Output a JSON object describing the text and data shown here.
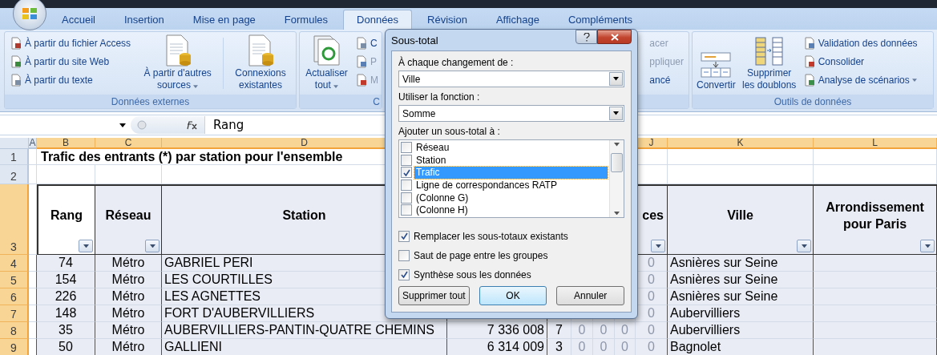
{
  "tabs": [
    {
      "label": "Accueil",
      "selected": false
    },
    {
      "label": "Insertion",
      "selected": false
    },
    {
      "label": "Mise en page",
      "selected": false
    },
    {
      "label": "Formules",
      "selected": false
    },
    {
      "label": "Données",
      "selected": true
    },
    {
      "label": "Révision",
      "selected": false
    },
    {
      "label": "Affichage",
      "selected": false
    },
    {
      "label": "Compléments",
      "selected": false
    }
  ],
  "ribbon": {
    "external_data": {
      "items": [
        "À partir du fichier Access",
        "À partir du site Web",
        "À partir du texte"
      ],
      "large": [
        {
          "label": "À partir d'autres sources",
          "menu": true
        },
        {
          "label": "Connexions existantes",
          "menu": false
        }
      ],
      "label": "Données externes"
    },
    "connections": {
      "large": {
        "label": "Actualiser tout",
        "menu": true
      },
      "items": [
        "C",
        "P",
        "M"
      ],
      "label": "C"
    },
    "sort_filter": {
      "items": [
        {
          "label": "acer",
          "disabled": true
        },
        {
          "label": "ppliquer",
          "disabled": true
        },
        {
          "label": "ancé",
          "disabled": false
        }
      ]
    },
    "data_tools": {
      "large": [
        {
          "label": "Convertir",
          "menu": false
        },
        {
          "label": "Supprimer les doublons",
          "menu": false
        }
      ],
      "items": [
        {
          "label": "Validation des données",
          "menu": false
        },
        {
          "label": "Consolider",
          "menu": false
        },
        {
          "label": "Analyse de scénarios",
          "menu": true
        }
      ],
      "label": "Outils de données"
    }
  },
  "formula_bar": {
    "formula": "Rang"
  },
  "sheet": {
    "column_headers": [
      {
        "label": "A",
        "selected": false
      },
      {
        "label": "B",
        "selected": true
      },
      {
        "label": "C",
        "selected": true
      },
      {
        "label": "D",
        "selected": true
      },
      {
        "label": "J",
        "selected": true
      },
      {
        "label": "K",
        "selected": true
      },
      {
        "label": "L",
        "selected": true
      }
    ],
    "title": "Trafic des entrants (*) par station pour l'ensemble",
    "header_cells": [
      {
        "label": "Rang",
        "active": true
      },
      {
        "label": "Réseau",
        "active": false
      },
      {
        "label": "Station",
        "active": false
      },
      {
        "label": "ces",
        "active": false
      },
      {
        "label": "Ville",
        "active": false
      },
      {
        "label": "Arrondissement pour Paris",
        "active": false
      }
    ],
    "row_numbers": [
      {
        "label": "1",
        "selected": false
      },
      {
        "label": "2",
        "selected": false
      },
      {
        "label": "3",
        "selected": true
      },
      {
        "label": "4",
        "selected": true
      },
      {
        "label": "5",
        "selected": true
      },
      {
        "label": "6",
        "selected": true
      },
      {
        "label": "7",
        "selected": true
      },
      {
        "label": "8",
        "selected": true
      },
      {
        "label": "9",
        "selected": true
      }
    ],
    "rows": [
      {
        "b": "74",
        "c": "Métro",
        "d": "GABRIEL PERI",
        "j": "0",
        "k": "Asnières sur Seine"
      },
      {
        "b": "154",
        "c": "Métro",
        "d": "LES COURTILLES",
        "j": "0",
        "k": "Asnières sur Seine"
      },
      {
        "b": "226",
        "c": "Métro",
        "d": "LES AGNETTES",
        "j": "0",
        "k": "Asnières sur Seine"
      },
      {
        "b": "148",
        "c": "Métro",
        "d": "FORT D'AUBERVILLIERS",
        "j": "0",
        "k": "Aubervilliers"
      },
      {
        "b": "35",
        "c": "Métro",
        "d": "AUBERVILLIERS-PANTIN-QUATRE CHEMINS",
        "e": "7 336 008",
        "f": "7",
        "g": "0",
        "h": "0",
        "i": "0",
        "j": "0",
        "k": "Aubervilliers"
      },
      {
        "b": "50",
        "c": "Métro",
        "d": "GALLIENI",
        "e": "6 314 009",
        "f": "3",
        "g": "0",
        "h": "0",
        "i": "0",
        "j": "0",
        "k": "Bagnolet"
      }
    ]
  },
  "dialog": {
    "title": "Sous-total",
    "change_label": "À chaque changement de :",
    "change_value": "Ville",
    "function_label": "Utiliser la fonction :",
    "function_value": "Somme",
    "list_label": "Ajouter un sous-total à :",
    "list_items": [
      {
        "label": "Réseau",
        "checked": false,
        "selected": false
      },
      {
        "label": "Station",
        "checked": false,
        "selected": false
      },
      {
        "label": "Trafic",
        "checked": true,
        "selected": true
      },
      {
        "label": "Ligne de correspondances RATP",
        "checked": false,
        "selected": false
      },
      {
        "label": "(Colonne G)",
        "checked": false,
        "selected": false
      },
      {
        "label": "(Colonne H)",
        "checked": false,
        "selected": false
      }
    ],
    "options": [
      {
        "label": "Remplacer les sous-totaux existants",
        "checked": true
      },
      {
        "label": "Saut de page entre les groupes",
        "checked": false
      },
      {
        "label": "Synthèse sous les données",
        "checked": true
      }
    ],
    "buttons": [
      {
        "label": "Supprimer tout",
        "default": false
      },
      {
        "label": "OK",
        "default": true
      },
      {
        "label": "Annuler",
        "default": false
      }
    ]
  }
}
